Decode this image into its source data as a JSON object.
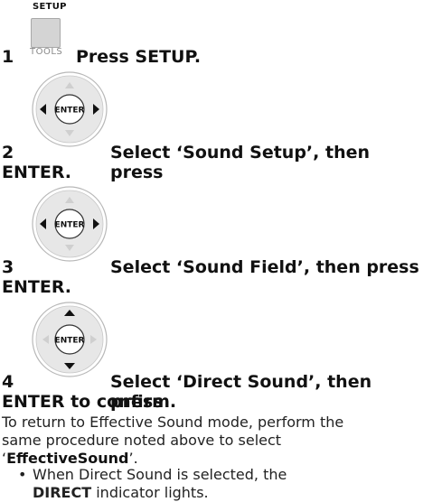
{
  "steps": [
    {
      "number": "1",
      "icon_top_label": "SETUP",
      "icon_bottom_label": "TOOLS",
      "text": "Press SETUP."
    },
    {
      "number": "2",
      "dpad_center": "ENTER",
      "text_line1": "Select ‘Sound Setup’, then press",
      "text_line2": "ENTER."
    },
    {
      "number": "3",
      "dpad_center": "ENTER",
      "text_line1": "Select ‘Sound Field’, then press",
      "text_line2": "ENTER."
    },
    {
      "number": "4",
      "dpad_center": "ENTER",
      "text_line1": "Select ‘Direct Sound’, then press",
      "text_line2": "ENTER to confirm."
    }
  ],
  "note": {
    "line1": "To return to Effective Sound mode, perform the",
    "line2": "same procedure noted above to select",
    "line3_prefix": "‘",
    "line3_bold": "EffectiveSound",
    "line3_suffix": "’."
  },
  "bullet": {
    "dot": "•",
    "line1": "When Direct Sound is selected, the",
    "line2_bold": "DIRECT",
    "line2_rest": " indicator lights."
  }
}
